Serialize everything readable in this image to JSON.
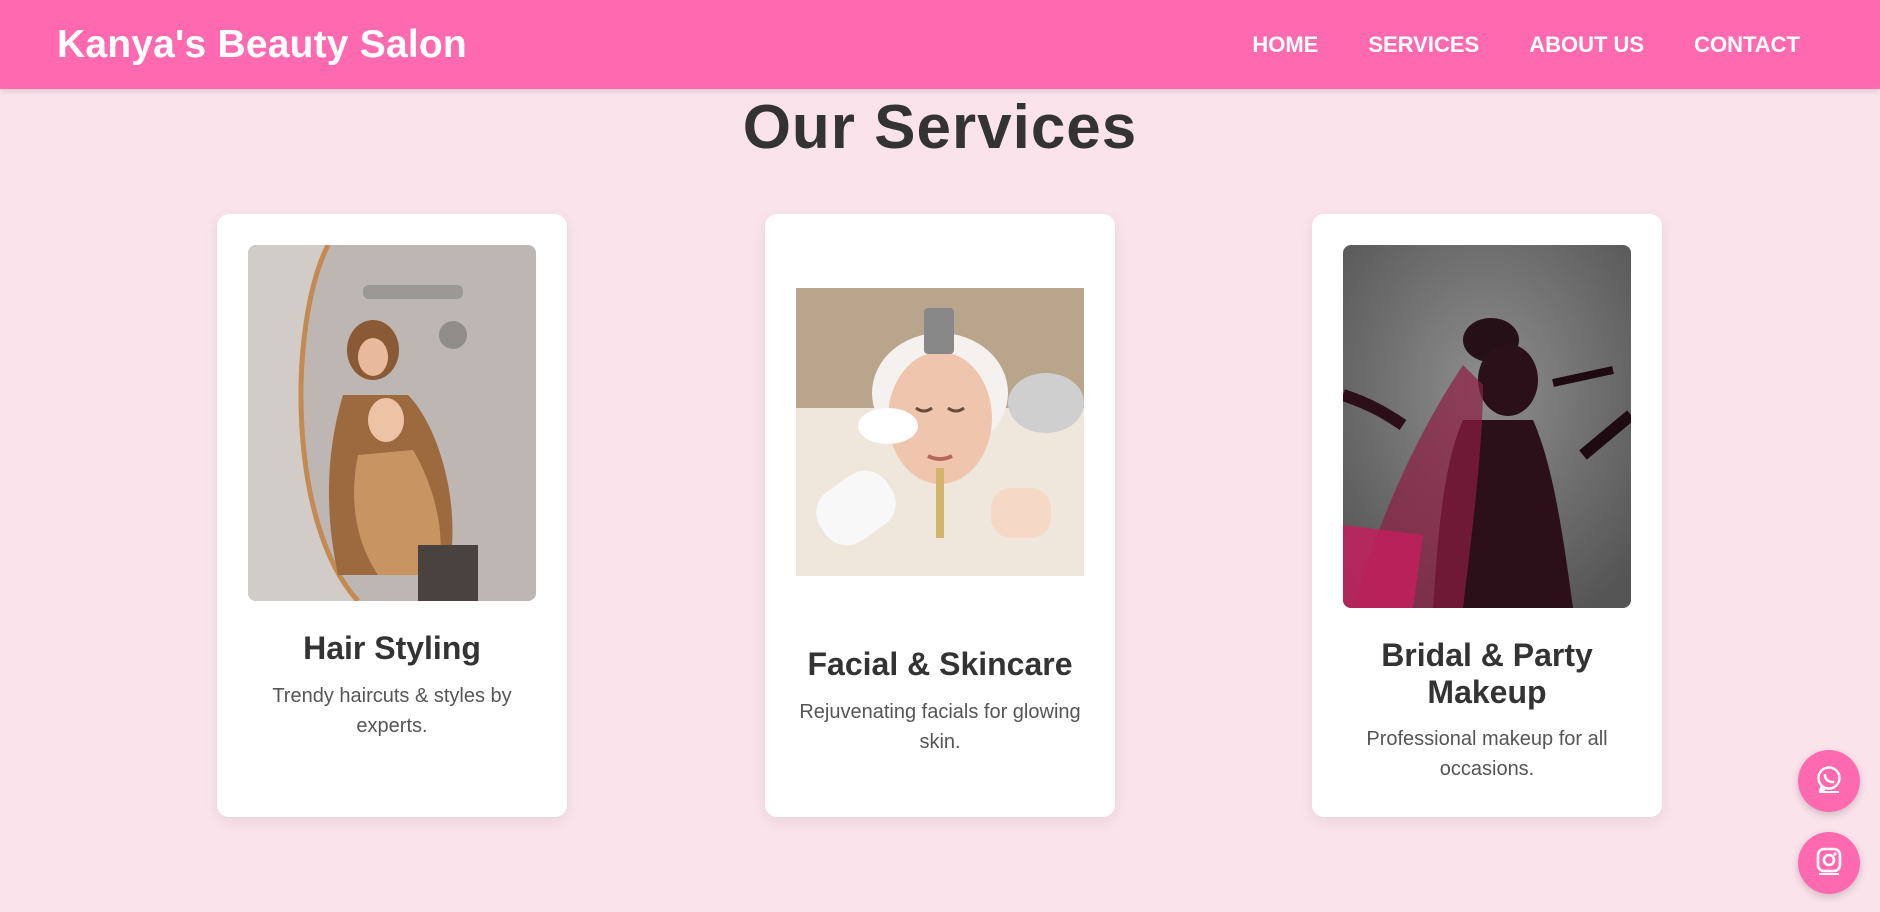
{
  "header": {
    "brand": "Kanya's Beauty Salon",
    "nav": [
      "HOME",
      "SERVICES",
      "ABOUT US",
      "CONTACT"
    ]
  },
  "services": {
    "title": "Our Services",
    "cards": [
      {
        "title": "Hair Styling",
        "description": "Trendy haircuts & styles by experts."
      },
      {
        "title": "Facial & Skincare",
        "description": "Rejuvenating facials for glowing skin."
      },
      {
        "title": "Bridal & Party Makeup",
        "description": "Professional makeup for all occasions."
      }
    ]
  },
  "floating_buttons": [
    {
      "icon": "whatsapp-icon"
    },
    {
      "icon": "instagram-icon"
    }
  ],
  "colors": {
    "accent": "#ff69b0",
    "background": "#fbe3ec",
    "card": "#ffffff",
    "text": "#333333"
  }
}
